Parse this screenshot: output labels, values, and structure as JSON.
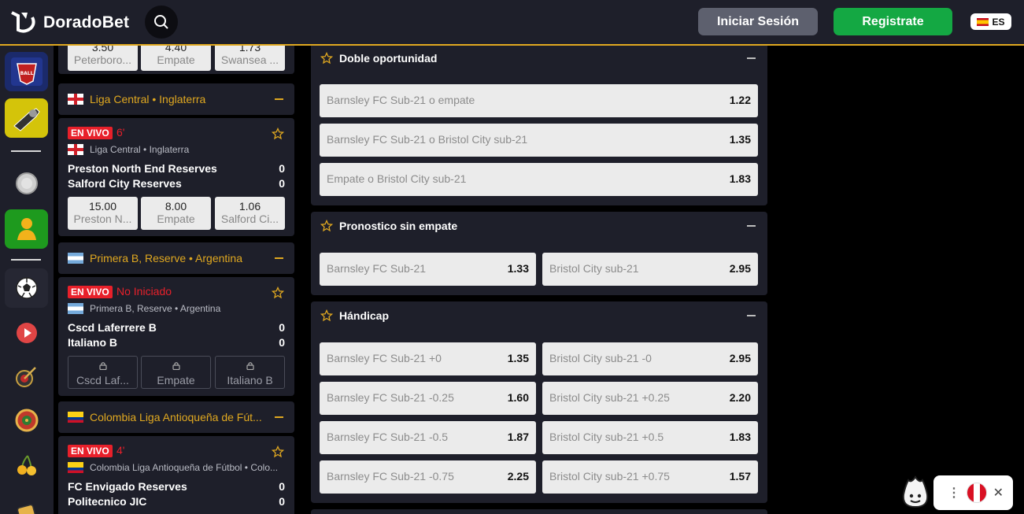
{
  "header": {
    "brand": "DoradoBet",
    "login_label": "Iniciar Sesión",
    "register_label": "Registrate",
    "lang_label": "ES",
    "accent_color": "#e0a820"
  },
  "rail": {
    "items": [
      "football-game-icon",
      "trophy-gun-icon",
      "coin-icon",
      "user-icon",
      "soccer-ball-icon",
      "play-icon",
      "darts-icon",
      "roulette-icon",
      "cherries-icon",
      "dice-icon"
    ]
  },
  "events": {
    "top_partial": {
      "odds": [
        {
          "value": "3.50",
          "name": "Peterboro..."
        },
        {
          "value": "4.40",
          "name": "Empate"
        },
        {
          "value": "1.73",
          "name": "Swansea ..."
        }
      ]
    },
    "leagues": [
      {
        "name": "Liga Central • Inglaterra",
        "match": {
          "live": "EN VIVO",
          "time": "6'",
          "league": "Liga Central • Inglaterra",
          "home": "Preston North End Reserves",
          "away": "Salford City Reserves",
          "home_score": "0",
          "away_score": "0",
          "odds": [
            {
              "value": "15.00",
              "name": "Preston N..."
            },
            {
              "value": "8.00",
              "name": "Empate"
            },
            {
              "value": "1.06",
              "name": "Salford Ci..."
            }
          ]
        }
      },
      {
        "name": "Primera B, Reserve • Argentina",
        "match": {
          "live": "EN VIVO",
          "time": "No Iniciado",
          "league": "Primera B, Reserve • Argentina",
          "home": "Cscd Laferrere B",
          "away": "Italiano B",
          "home_score": "0",
          "away_score": "0",
          "odds": [
            {
              "value": "",
              "name": "Cscd Laf..."
            },
            {
              "value": "",
              "name": "Empate"
            },
            {
              "value": "",
              "name": "Italiano B"
            }
          ]
        }
      },
      {
        "name": "Colombia Liga Antioqueña de Fút...",
        "match": {
          "live": "EN VIVO",
          "time": "4'",
          "league": "Colombia Liga Antioqueña de Fútbol • Colo...",
          "home": "FC Envigado Reserves",
          "away": "Politecnico JIC",
          "home_score": "0",
          "away_score": "0"
        }
      }
    ]
  },
  "markets": [
    {
      "title": "Doble oportunidad",
      "selections": [
        {
          "name": "Barnsley FC Sub-21 o empate",
          "odd": "1.22"
        },
        {
          "name": "Barnsley FC Sub-21 o Bristol City sub-21",
          "odd": "1.35"
        },
        {
          "name": "Empate o Bristol City sub-21",
          "odd": "1.83"
        }
      ]
    },
    {
      "title": "Pronostico sin empate",
      "selections": [
        {
          "name": "Barnsley FC Sub-21",
          "odd": "1.33"
        },
        {
          "name": "Bristol City sub-21",
          "odd": "2.95"
        }
      ]
    },
    {
      "title": "Hándicap",
      "selections": [
        {
          "name": "Barnsley FC Sub-21 +0",
          "odd": "1.35"
        },
        {
          "name": "Bristol City sub-21 -0",
          "odd": "2.95"
        },
        {
          "name": "Barnsley FC Sub-21 -0.25",
          "odd": "1.60"
        },
        {
          "name": "Bristol City sub-21 +0.25",
          "odd": "2.20"
        },
        {
          "name": "Barnsley FC Sub-21 -0.5",
          "odd": "1.87"
        },
        {
          "name": "Bristol City sub-21 +0.5",
          "odd": "1.83"
        },
        {
          "name": "Barnsley FC Sub-21 -0.75",
          "odd": "2.25"
        },
        {
          "name": "Bristol City sub-21 +0.75",
          "odd": "1.57"
        }
      ]
    }
  ]
}
